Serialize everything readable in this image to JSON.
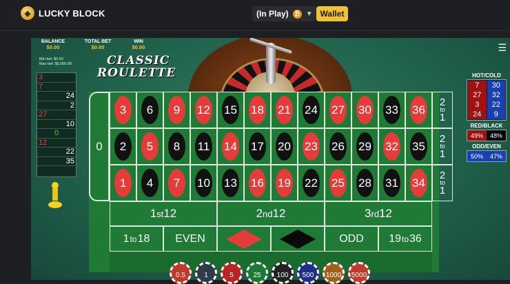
{
  "header": {
    "logo_text": "LUCKY BLOCK",
    "status_label": "(In Play)",
    "currency_symbol": "₿",
    "wallet_label": "Wallet"
  },
  "game": {
    "stats": [
      {
        "label": "BALANCE",
        "value": "$0.00"
      },
      {
        "label": "TOTAL BET",
        "value": "$0.00"
      },
      {
        "label": "WIN",
        "value": "$0.00"
      }
    ],
    "limits": {
      "min": "Min bet: $0.50",
      "max": "Max bet: $5,000.00"
    },
    "title_line1": "CLASSIC",
    "title_line2": "ROULETTE"
  },
  "history": [
    {
      "value": "3",
      "color": "red"
    },
    {
      "value": "7",
      "color": "red"
    },
    {
      "value": "24",
      "color": "black"
    },
    {
      "value": "2",
      "color": "black"
    },
    {
      "value": "27",
      "color": "red"
    },
    {
      "value": "10",
      "color": "black"
    },
    {
      "value": "0",
      "color": "green"
    },
    {
      "value": "12",
      "color": "red"
    },
    {
      "value": "22",
      "color": "black"
    },
    {
      "value": "35",
      "color": "black"
    }
  ],
  "board": {
    "zero": "0",
    "rows": [
      [
        {
          "n": "3",
          "c": "red"
        },
        {
          "n": "6",
          "c": "black"
        },
        {
          "n": "9",
          "c": "red"
        },
        {
          "n": "12",
          "c": "red"
        },
        {
          "n": "15",
          "c": "black"
        },
        {
          "n": "18",
          "c": "red"
        },
        {
          "n": "21",
          "c": "red"
        },
        {
          "n": "24",
          "c": "black"
        },
        {
          "n": "27",
          "c": "red"
        },
        {
          "n": "30",
          "c": "red"
        },
        {
          "n": "33",
          "c": "black"
        },
        {
          "n": "36",
          "c": "red"
        }
      ],
      [
        {
          "n": "2",
          "c": "black"
        },
        {
          "n": "5",
          "c": "red"
        },
        {
          "n": "8",
          "c": "black"
        },
        {
          "n": "11",
          "c": "black"
        },
        {
          "n": "14",
          "c": "red"
        },
        {
          "n": "17",
          "c": "black"
        },
        {
          "n": "20",
          "c": "black"
        },
        {
          "n": "23",
          "c": "red"
        },
        {
          "n": "26",
          "c": "black"
        },
        {
          "n": "29",
          "c": "black"
        },
        {
          "n": "32",
          "c": "red"
        },
        {
          "n": "35",
          "c": "black"
        }
      ],
      [
        {
          "n": "1",
          "c": "red"
        },
        {
          "n": "4",
          "c": "black"
        },
        {
          "n": "7",
          "c": "red"
        },
        {
          "n": "10",
          "c": "black"
        },
        {
          "n": "13",
          "c": "black"
        },
        {
          "n": "16",
          "c": "red"
        },
        {
          "n": "19",
          "c": "red"
        },
        {
          "n": "22",
          "c": "black"
        },
        {
          "n": "25",
          "c": "red"
        },
        {
          "n": "28",
          "c": "black"
        },
        {
          "n": "31",
          "c": "black"
        },
        {
          "n": "34",
          "c": "red"
        }
      ]
    ],
    "column_bet": {
      "top": "2",
      "mid": "to",
      "bottom": "1"
    },
    "dozens": [
      {
        "pre": "1",
        "sup": "st",
        "post": "12"
      },
      {
        "pre": "2",
        "sup": "nd",
        "post": "12"
      },
      {
        "pre": "3",
        "sup": "rd",
        "post": "12"
      }
    ],
    "outside": {
      "low": {
        "a": "1",
        "to": "to",
        "b": "18"
      },
      "even": "EVEN",
      "odd": "ODD",
      "high": {
        "a": "19",
        "to": "to",
        "b": "36"
      }
    }
  },
  "hot_cold": {
    "title": "HOT/COLD",
    "hot": [
      "7",
      "27",
      "3",
      "24"
    ],
    "cold": [
      "30",
      "32",
      "22",
      "9"
    ]
  },
  "red_black": {
    "title": "RED/BLACK",
    "red": "49%",
    "black": "48%"
  },
  "odd_even": {
    "title": "ODD/EVEN",
    "odd": "50%",
    "even": "47%"
  },
  "chips": [
    {
      "label": "0.5",
      "color": "#c0392b"
    },
    {
      "label": "1",
      "color": "#2f3b4a"
    },
    {
      "label": "5",
      "color": "#b82323"
    },
    {
      "label": "25",
      "color": "#1e7a33"
    },
    {
      "label": "100",
      "color": "#222222"
    },
    {
      "label": "500",
      "color": "#1f2f8a"
    },
    {
      "label": "1000",
      "color": "#a0601c"
    },
    {
      "label": "5000",
      "color": "#c0392b"
    }
  ]
}
